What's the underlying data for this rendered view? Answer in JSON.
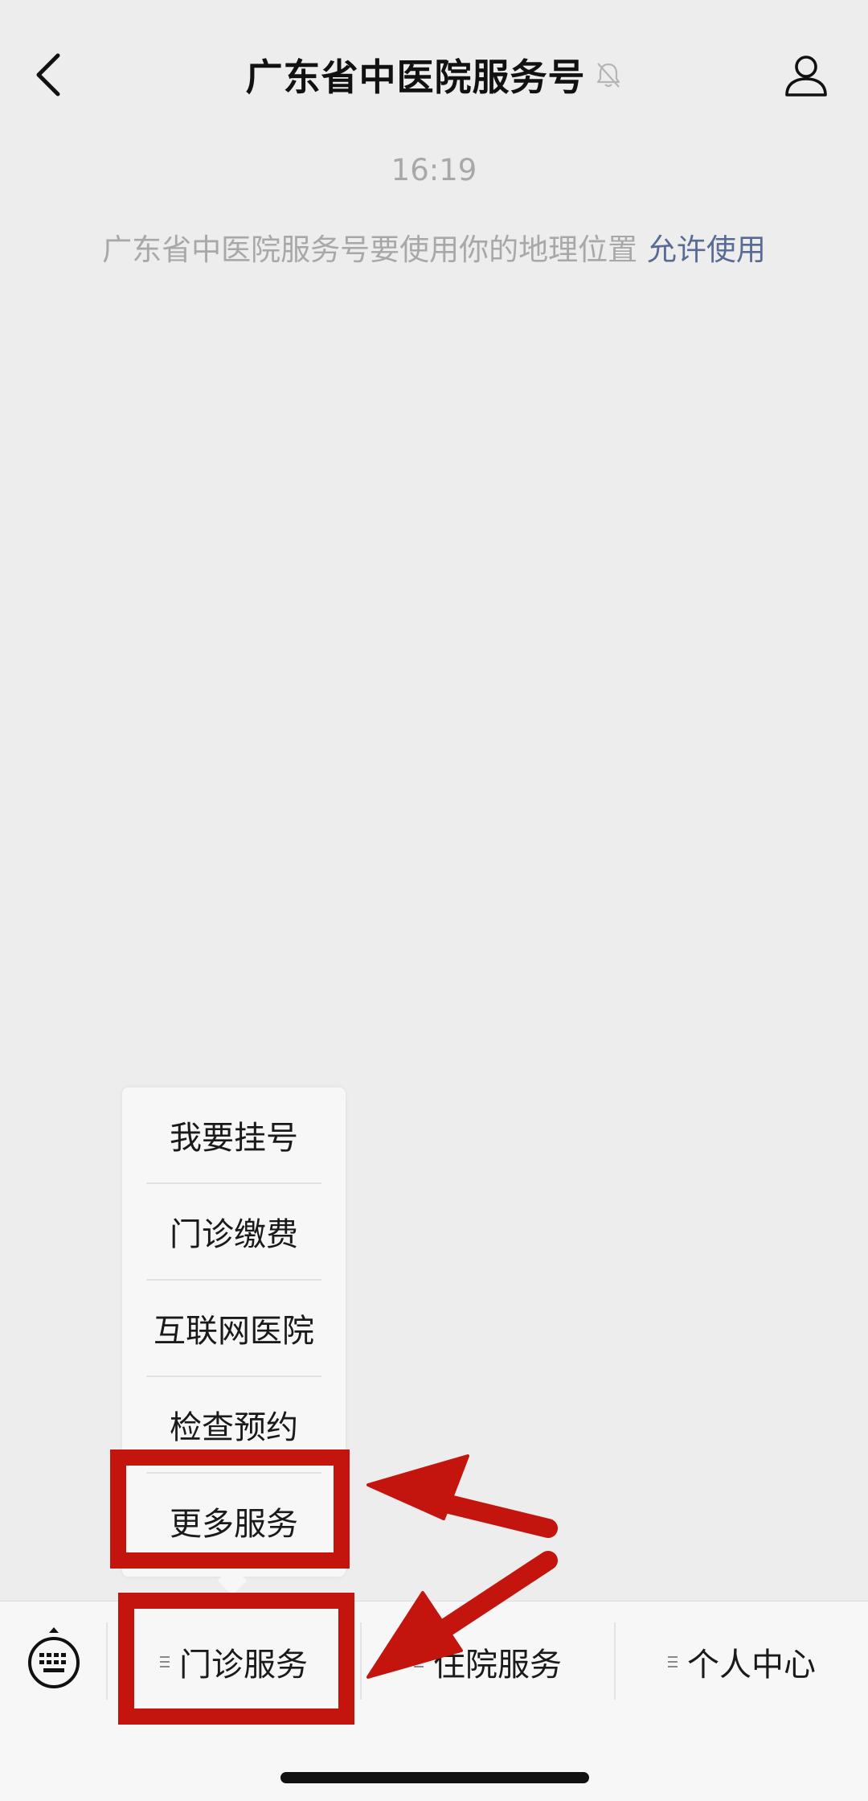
{
  "header": {
    "title": "广东省中医院服务号",
    "icons": {
      "back": "chevron-left-icon",
      "mute": "bell-muted-icon",
      "profile": "person-icon"
    }
  },
  "chat": {
    "timestamp": "16:19",
    "notice_text": "广东省中医院服务号要使用你的地理位置",
    "notice_link": "允许使用",
    "link_color": "#576b95"
  },
  "submenu": {
    "items": [
      {
        "label": "我要挂号"
      },
      {
        "label": "门诊缴费"
      },
      {
        "label": "互联网医院"
      },
      {
        "label": "检查预约"
      },
      {
        "label": "更多服务"
      }
    ]
  },
  "bottom_menu": {
    "keyboard_icon": "keyboard-icon",
    "items": [
      {
        "label": "门诊服务"
      },
      {
        "label": "住院服务"
      },
      {
        "label": "个人中心"
      }
    ]
  },
  "annotations": {
    "color": "#c4140e"
  }
}
